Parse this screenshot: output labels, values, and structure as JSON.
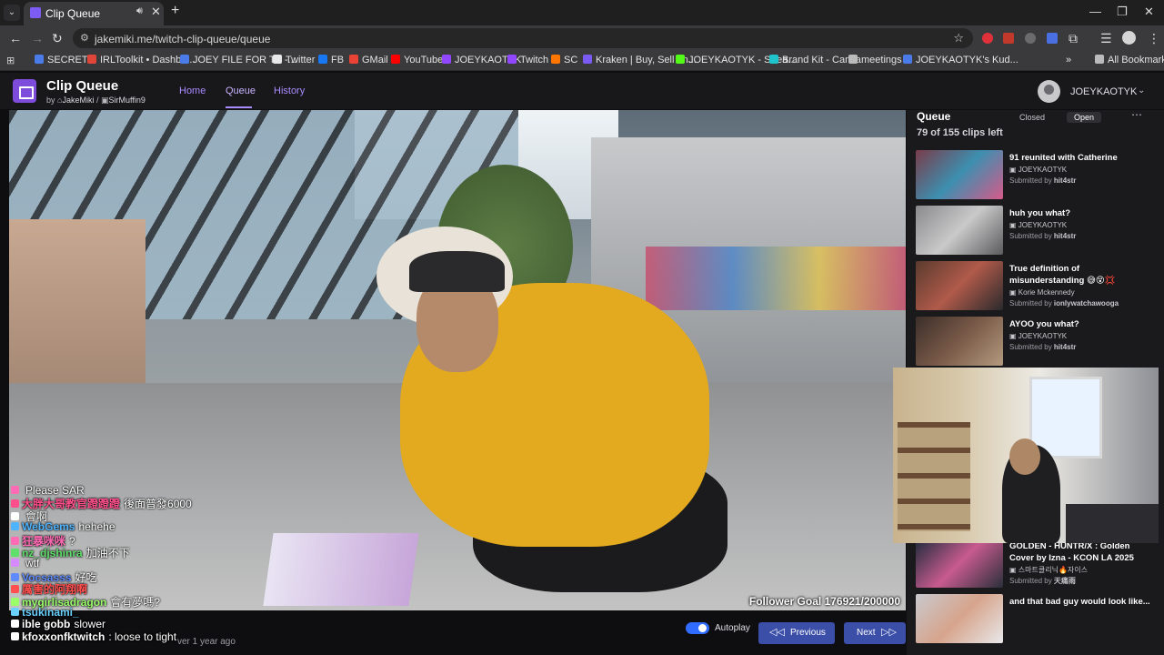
{
  "browser": {
    "tab_title": "Clip Queue",
    "url": "jakemiki.me/twitch-clip-queue/queue",
    "bookmarks": [
      {
        "label": "SECRETS",
        "color": "#4a7be8"
      },
      {
        "label": "IRLToolkit • Dashbo...",
        "color": "#e0453a"
      },
      {
        "label": "JOEY FILE FOR TP -...",
        "color": "#4a7be8"
      },
      {
        "label": "Twitter",
        "color": "#e8e8e8"
      },
      {
        "label": "FB",
        "color": "#1877f2"
      },
      {
        "label": "GMail",
        "color": "#ea4335"
      },
      {
        "label": "YouTube",
        "color": "#ff0000"
      },
      {
        "label": "JOEYKAOTYK",
        "color": "#9146ff"
      },
      {
        "label": "Twitch",
        "color": "#9146ff"
      },
      {
        "label": "SC",
        "color": "#ff7700"
      },
      {
        "label": "Kraken | Buy, Sell an...",
        "color": "#7a5cf5"
      },
      {
        "label": "JOEYKAOTYK - Strea...",
        "color": "#53fc18"
      },
      {
        "label": "Brand Kit - Canva",
        "color": "#20c4cb"
      },
      {
        "label": "meetings",
        "color": "#bbbbbb"
      },
      {
        "label": "JOEYKAOTYK's Kud...",
        "color": "#4a7be8"
      }
    ],
    "all_bookmarks": "All Bookmarks"
  },
  "site": {
    "title": "Clip Queue",
    "by_prefix": "by",
    "author": "JakeMiki",
    "separator": "/",
    "coauthor": "SirMuffin9",
    "nav": {
      "home": "Home",
      "queue": "Queue",
      "history": "History"
    },
    "user": "JOEYKAOTYK"
  },
  "video": {
    "follower_goal": "Follower Goal 176921/200000"
  },
  "chat": [
    {
      "user": "",
      "msg": "Please SAR",
      "color": "#ff6bb5"
    },
    {
      "user": "大胖大哥教官蹬蹬蹬",
      "msg": "後面普發6000",
      "color": "#ff4f8b"
    },
    {
      "user": "",
      "msg": "會啊",
      "color": "#ffffff"
    },
    {
      "user": "WebGems",
      "msg": "hehehe",
      "color": "#4fb4ff"
    },
    {
      "user": "狂暴咪咪",
      "msg": "?",
      "color": "#ff6bb5"
    },
    {
      "user": "nz_djshinra",
      "msg": "加油不下",
      "color": "#5fe06a"
    },
    {
      "user": "",
      "msg": "wtf",
      "color": "#d58bff"
    },
    {
      "user": "Vocsasss",
      "msg": "好吃",
      "color": "#5f8bff"
    },
    {
      "user": "厲害的阿翔啊",
      "msg": "",
      "color": "#ff4f4f"
    },
    {
      "user": "mygirlisadragon",
      "msg": "會有夢嗎?",
      "color": "#9bff6a"
    },
    {
      "user": "tsukinami_",
      "msg": "",
      "color": "#6ad1ff"
    },
    {
      "user": "ible gobb",
      "msg": "slower",
      "color": "#ffffff"
    },
    {
      "user": "kfoxxonfktwitch",
      "msg": ": loose to tight",
      "color": "#ffffff"
    }
  ],
  "queue": {
    "title": "Queue",
    "tab_closed": "Closed",
    "tab_open": "Open",
    "count": "79 of 155 clips left",
    "items": [
      {
        "title": "91 reunited with Catherine",
        "channel": "JOEYKAOTYK",
        "submitted_by": "hit4str",
        "thumb": [
          "#7a3c4a",
          "#3d8fb0",
          "#d65a89"
        ]
      },
      {
        "title": "huh you what?",
        "channel": "JOEYKAOTYK",
        "submitted_by": "hit4str",
        "thumb": [
          "#8a8a8c",
          "#c9c9ca",
          "#5b5b5d"
        ]
      },
      {
        "title": "True definition of misunderstanding 😅😵💢",
        "channel": "Korie Mckennedy",
        "submitted_by": "ionlywatchawooga",
        "thumb": [
          "#5a3b2e",
          "#b05a4a",
          "#2a2a2c"
        ]
      },
      {
        "title": "AYOO you what?",
        "channel": "JOEYKAOTYK",
        "submitted_by": "hit4str",
        "thumb": [
          "#3b2f2a",
          "#7a5a48",
          "#b39a7e"
        ]
      },
      {
        "title": "GOLDEN - HUNTR/X : Golden Cover by Izna - KCON LA 2025",
        "channel": "스마트클리닉🔥자이스",
        "submitted_by": "天痛雨",
        "thumb": [
          "#1c2a3a",
          "#c85b8f",
          "#2a2f3a"
        ]
      },
      {
        "title": "and that bad guy would look like...",
        "channel": "",
        "submitted_by": "",
        "thumb": [
          "#c9c9ce",
          "#d7a48c",
          "#e8e8ea"
        ]
      }
    ]
  },
  "controls": {
    "meta": "ver 1 year ago",
    "autoplay": "Autoplay",
    "previous": "Previous",
    "next": "Next"
  }
}
